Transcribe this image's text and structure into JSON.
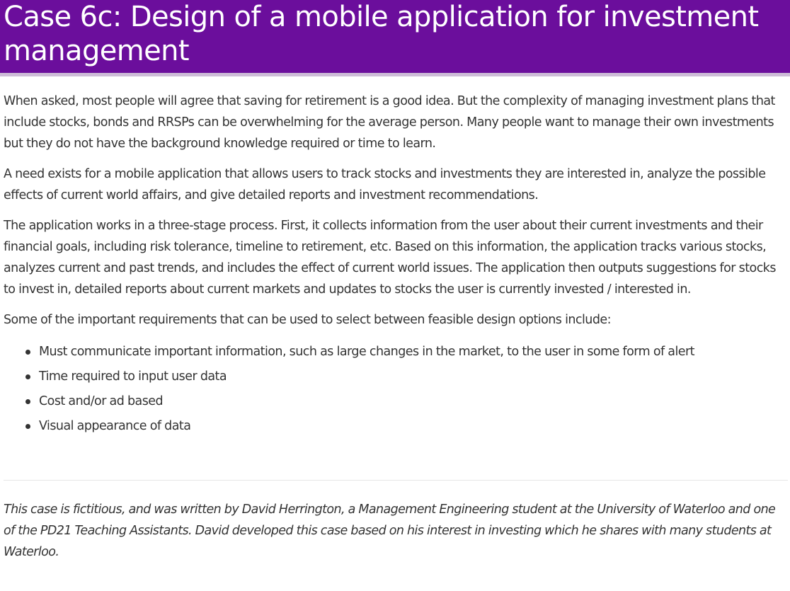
{
  "header": {
    "title_line1": "Case 6c: Design of a mobile application for investment",
    "title_line2": "management"
  },
  "body": {
    "paragraphs": [
      "When asked, most people will agree that saving for retirement is a good idea. But the complexity of managing investment plans that include stocks, bonds and RRSPs can be overwhelming for the average person. Many people want to manage their own investments but they do not have the background knowledge required or time to learn.",
      "A need exists for a mobile application that allows users to track stocks and investments they are interested in, analyze the possible effects of current world affairs, and give detailed reports and investment recommendations.",
      "The application works in a three-stage process. First, it collects information from the user about their current investments and their financial goals, including risk tolerance, timeline to retirement, etc. Based on this information, the application tracks various stocks, analyzes current and past trends, and includes the effect of current world issues. The application then outputs suggestions for stocks to invest in, detailed reports about current markets and updates to stocks the user is currently invested / interested in.",
      "Some of the important requirements that can be used to select between feasible design options include:"
    ],
    "requirements": [
      "Must communicate important information, such as large changes in the market, to the user in some form of alert",
      "Time required to input user data",
      "Cost and/or ad based",
      "Visual appearance of data"
    ]
  },
  "footnote": {
    "text": "This case is fictitious, and was written by David Herrington, a Management Engineering student at the University of Waterloo and one of the PD21 Teaching Assistants. David developed this case based on his interest in investing which he shares with many students at Waterloo."
  },
  "colors": {
    "header_background": "#6b0e9c",
    "header_underline": "#cdbcd7",
    "body_text": "#333333",
    "divider": "#e6e6e6"
  }
}
